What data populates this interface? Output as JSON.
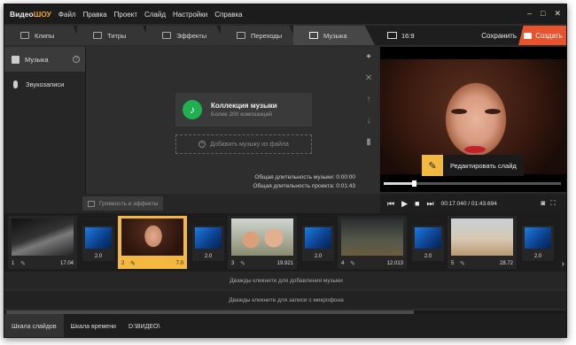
{
  "app": {
    "logo_prefix": "Видео",
    "logo_suffix": "ШОУ"
  },
  "menu": [
    "Файл",
    "Правка",
    "Проект",
    "Слайд",
    "Настройки",
    "Справка"
  ],
  "tabs": [
    {
      "label": "Клипы",
      "icon": "clips-icon"
    },
    {
      "label": "Титры",
      "icon": "titles-icon"
    },
    {
      "label": "Эффекты",
      "icon": "effects-icon"
    },
    {
      "label": "Переходы",
      "icon": "transitions-icon"
    },
    {
      "label": "Музыка",
      "icon": "music-icon",
      "active": true
    }
  ],
  "topright": {
    "ratio": "16:9",
    "save": "Сохранить",
    "create": "Создать"
  },
  "sidebar": {
    "items": [
      {
        "label": "Музыка"
      },
      {
        "label": "Звукозаписи"
      }
    ]
  },
  "music": {
    "collection_title": "Коллекция музыки",
    "collection_sub": "Более 200 композиций",
    "add_label": "Добавить музыку из файла",
    "music_duration": "Общая длительность музыки: 0:00:00",
    "project_duration": "Общая длительность проекта: 0:01:43"
  },
  "preview": {
    "edit_label": "Редактировать слайд",
    "time": "00:17.040 / 01:43.694",
    "progress": 0.17
  },
  "subbar": {
    "volume_label": "Громкость и эффекты"
  },
  "slides": [
    {
      "num": "1",
      "dur": "17.04"
    },
    {
      "num": "2",
      "dur": "7.0"
    },
    {
      "num": "3",
      "dur": "19.921"
    },
    {
      "num": "4",
      "dur": "12.013"
    },
    {
      "num": "5",
      "dur": "28.72"
    }
  ],
  "transitions": [
    "2.0",
    "2.0",
    "2.0",
    "2.0",
    "2.0"
  ],
  "tracks": {
    "music": "Дважды кликните для добавления музыки",
    "mic": "Дважды кликните для записи с микрофона"
  },
  "bottom": {
    "tab1": "Шкала слайдов",
    "tab2": "Шкала времени",
    "path": "D:\\ВИДЕО\\"
  },
  "colors": {
    "accent": "#f2b840",
    "create": "#e6532d",
    "spotify": "#20b050"
  }
}
